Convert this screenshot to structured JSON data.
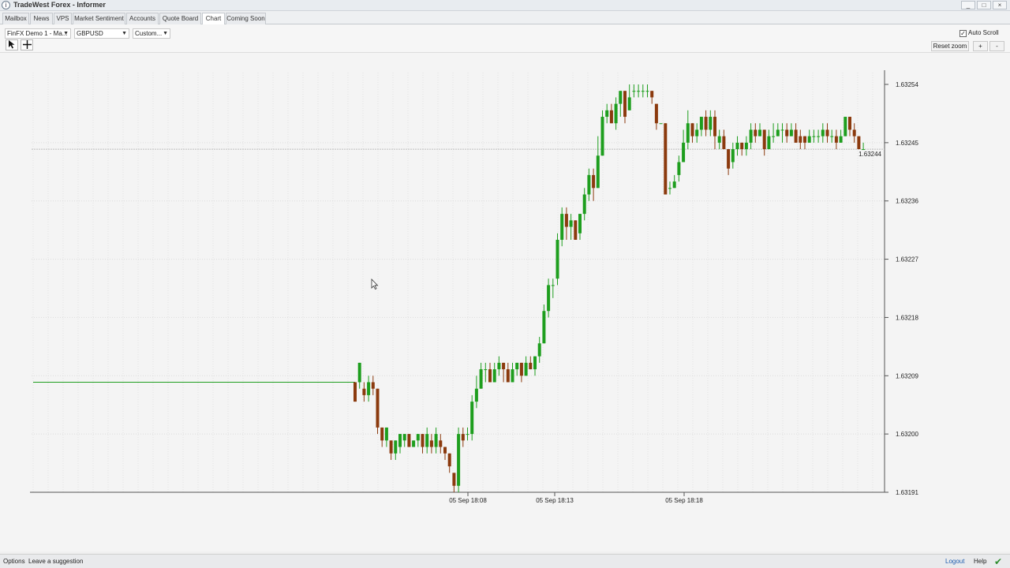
{
  "window": {
    "title": "TradeWest Forex - Informer",
    "icon": "info-icon",
    "controls": [
      "_",
      "□",
      "×"
    ]
  },
  "tabs": [
    {
      "label": "Mailbox",
      "active": false
    },
    {
      "label": "News",
      "active": false
    },
    {
      "label": "VPS",
      "active": false
    },
    {
      "label": "Market Sentiment",
      "active": false
    },
    {
      "label": "Accounts",
      "active": false
    },
    {
      "label": "Quote Board",
      "active": false
    },
    {
      "label": "Chart",
      "active": true
    },
    {
      "label": "Coming Soon",
      "active": false
    }
  ],
  "toolbar": {
    "account_select": "FinFX Demo 1 - Ma...",
    "symbol_select": "GBPUSD",
    "timeframe_select": "Custom...",
    "pointer_tool_icon": "cursor-icon",
    "crosshair_tool_icon": "crosshair-icon",
    "auto_scroll_label": "Auto Scroll",
    "auto_scroll_checked": true,
    "reset_zoom_label": "Reset zoom",
    "zoom_in_label": "+",
    "zoom_out_label": "-"
  },
  "chart_data": {
    "type": "candlestick",
    "symbol": "GBPUSD",
    "y_ticks": [
      "1.63254",
      "1.63245",
      "1.63236",
      "1.63227",
      "1.63218",
      "1.63209",
      "1.63200",
      "1.63191"
    ],
    "ylim": [
      1.63191,
      1.63254
    ],
    "x_ticks": [
      "05 Sep 18:08",
      "05 Sep 18:13",
      "05 Sep 18:18"
    ],
    "current_price": "1.63244",
    "up_color": "#1e9e1e",
    "down_color": "#8b3a0e",
    "flat_price_before_start": 1.63208,
    "candles": [
      [
        1.63208,
        1.63205,
        1.63208,
        1.63205
      ],
      [
        1.63208,
        1.63211,
        1.63211,
        1.63207
      ],
      [
        1.63207,
        1.63206,
        1.63208,
        1.63205
      ],
      [
        1.63206,
        1.63208,
        1.63209,
        1.63205
      ],
      [
        1.63208,
        1.63207,
        1.63209,
        1.63206
      ],
      [
        1.63207,
        1.63201,
        1.63207,
        1.632
      ],
      [
        1.63201,
        1.63199,
        1.63201,
        1.63198
      ],
      [
        1.63199,
        1.63201,
        1.63201,
        1.63198
      ],
      [
        1.63199,
        1.63197,
        1.63199,
        1.63196
      ],
      [
        1.63197,
        1.63199,
        1.63199,
        1.63196
      ],
      [
        1.63198,
        1.632,
        1.632,
        1.63197
      ],
      [
        1.63199,
        1.632,
        1.632,
        1.63198
      ],
      [
        1.632,
        1.63198,
        1.632,
        1.63198
      ],
      [
        1.63198,
        1.63199,
        1.63199,
        1.63198
      ],
      [
        1.63199,
        1.632,
        1.632,
        1.63198
      ],
      [
        1.632,
        1.63198,
        1.632,
        1.63197
      ],
      [
        1.63198,
        1.632,
        1.63201,
        1.63197
      ],
      [
        1.63199,
        1.63198,
        1.632,
        1.63197
      ],
      [
        1.63198,
        1.632,
        1.63201,
        1.63197
      ],
      [
        1.63199,
        1.63198,
        1.632,
        1.63197
      ],
      [
        1.63198,
        1.63197,
        1.63198,
        1.63196
      ],
      [
        1.63197,
        1.63195,
        1.63197,
        1.63194
      ],
      [
        1.63194,
        1.63192,
        1.63194,
        1.63191
      ],
      [
        1.63192,
        1.632,
        1.63201,
        1.63191
      ],
      [
        1.632,
        1.63199,
        1.63201,
        1.63198
      ],
      [
        1.632,
        1.632,
        1.63201,
        1.63199
      ],
      [
        1.632,
        1.63205,
        1.63206,
        1.63199
      ],
      [
        1.63205,
        1.63207,
        1.63209,
        1.63204
      ],
      [
        1.63207,
        1.6321,
        1.63211,
        1.63207
      ],
      [
        1.6321,
        1.6321,
        1.63211,
        1.63208
      ],
      [
        1.6321,
        1.63208,
        1.63211,
        1.63208
      ],
      [
        1.63208,
        1.6321,
        1.63211,
        1.63208
      ],
      [
        1.6321,
        1.63211,
        1.63212,
        1.63209
      ],
      [
        1.63211,
        1.6321,
        1.63211,
        1.63208
      ],
      [
        1.6321,
        1.63208,
        1.63211,
        1.63208
      ],
      [
        1.63208,
        1.6321,
        1.63211,
        1.63208
      ],
      [
        1.6321,
        1.63211,
        1.63211,
        1.63209
      ],
      [
        1.63211,
        1.63209,
        1.63211,
        1.63208
      ],
      [
        1.63209,
        1.63211,
        1.63212,
        1.63209
      ],
      [
        1.63211,
        1.6321,
        1.63212,
        1.6321
      ],
      [
        1.6321,
        1.63212,
        1.63212,
        1.63209
      ],
      [
        1.63212,
        1.63214,
        1.63215,
        1.63211
      ],
      [
        1.63214,
        1.63219,
        1.6322,
        1.63214
      ],
      [
        1.63219,
        1.63223,
        1.63224,
        1.63218
      ],
      [
        1.63223,
        1.63223,
        1.63224,
        1.63221
      ],
      [
        1.63224,
        1.6323,
        1.63231,
        1.63223
      ],
      [
        1.6323,
        1.63234,
        1.63235,
        1.63229
      ],
      [
        1.63234,
        1.63232,
        1.63235,
        1.6323
      ],
      [
        1.63232,
        1.63233,
        1.63234,
        1.6323
      ],
      [
        1.63233,
        1.6323,
        1.63233,
        1.6323
      ],
      [
        1.63231,
        1.63234,
        1.63234,
        1.6323
      ],
      [
        1.63234,
        1.63237,
        1.63238,
        1.63233
      ],
      [
        1.63237,
        1.6324,
        1.63241,
        1.63236
      ],
      [
        1.6324,
        1.63238,
        1.63241,
        1.63236
      ],
      [
        1.63238,
        1.63243,
        1.63246,
        1.63238
      ],
      [
        1.63243,
        1.63249,
        1.6325,
        1.63243
      ],
      [
        1.63249,
        1.6325,
        1.63251,
        1.63248
      ],
      [
        1.6325,
        1.63248,
        1.63251,
        1.63248
      ],
      [
        1.63248,
        1.63251,
        1.63252,
        1.63247
      ],
      [
        1.63251,
        1.63253,
        1.63253,
        1.63249
      ],
      [
        1.63253,
        1.63249,
        1.63253,
        1.63248
      ],
      [
        1.6325,
        1.63252,
        1.63254,
        1.6325
      ],
      [
        1.63253,
        1.63253,
        1.63254,
        1.63252
      ],
      [
        1.63253,
        1.63253,
        1.63254,
        1.63252
      ],
      [
        1.63253,
        1.63253,
        1.63254,
        1.63252
      ],
      [
        1.63253,
        1.63253,
        1.63254,
        1.63252
      ],
      [
        1.63253,
        1.63252,
        1.63253,
        1.63251
      ],
      [
        1.63251,
        1.63248,
        1.63251,
        1.63247
      ],
      [
        1.63248,
        1.63248,
        1.63248,
        1.63248
      ],
      [
        1.63248,
        1.63237,
        1.63248,
        1.63237
      ],
      [
        1.63238,
        1.63238,
        1.63239,
        1.63237
      ],
      [
        1.63238,
        1.63239,
        1.6324,
        1.63238
      ],
      [
        1.6324,
        1.63242,
        1.63243,
        1.63239
      ],
      [
        1.63242,
        1.63245,
        1.63247,
        1.63242
      ],
      [
        1.63245,
        1.63248,
        1.6325,
        1.63244
      ],
      [
        1.63248,
        1.63246,
        1.63248,
        1.63245
      ],
      [
        1.63246,
        1.63247,
        1.63248,
        1.63245
      ],
      [
        1.63247,
        1.63249,
        1.63249,
        1.63246
      ],
      [
        1.63249,
        1.63247,
        1.6325,
        1.63246
      ],
      [
        1.63247,
        1.63249,
        1.6325,
        1.63246
      ],
      [
        1.63249,
        1.63246,
        1.6325,
        1.63244
      ],
      [
        1.63245,
        1.63246,
        1.63247,
        1.63244
      ],
      [
        1.63246,
        1.63244,
        1.63247,
        1.63244
      ],
      [
        1.63244,
        1.63241,
        1.63244,
        1.6324
      ],
      [
        1.63242,
        1.63244,
        1.63245,
        1.63241
      ],
      [
        1.63244,
        1.63245,
        1.63246,
        1.63243
      ],
      [
        1.63245,
        1.63244,
        1.63245,
        1.63243
      ],
      [
        1.63244,
        1.63245,
        1.63246,
        1.63243
      ],
      [
        1.63245,
        1.63247,
        1.63248,
        1.63244
      ],
      [
        1.63247,
        1.63246,
        1.63248,
        1.63245
      ],
      [
        1.63246,
        1.63247,
        1.63248,
        1.63246
      ],
      [
        1.63247,
        1.63244,
        1.63247,
        1.63243
      ],
      [
        1.63244,
        1.63246,
        1.63247,
        1.63244
      ],
      [
        1.63246,
        1.63246,
        1.63248,
        1.63245
      ],
      [
        1.63246,
        1.63247,
        1.63248,
        1.63246
      ],
      [
        1.63247,
        1.63247,
        1.63248,
        1.63245
      ],
      [
        1.63247,
        1.63246,
        1.63248,
        1.63245
      ],
      [
        1.63246,
        1.63247,
        1.63248,
        1.63246
      ],
      [
        1.63247,
        1.63245,
        1.63248,
        1.63245
      ],
      [
        1.63246,
        1.63245,
        1.63247,
        1.63244
      ],
      [
        1.63246,
        1.63245,
        1.63246,
        1.63244
      ],
      [
        1.63245,
        1.63246,
        1.63247,
        1.63245
      ],
      [
        1.63246,
        1.63246,
        1.63247,
        1.63245
      ],
      [
        1.63246,
        1.63246,
        1.63247,
        1.63245
      ],
      [
        1.63246,
        1.63247,
        1.63248,
        1.63245
      ],
      [
        1.63247,
        1.63246,
        1.63248,
        1.63245
      ],
      [
        1.63246,
        1.63246,
        1.63247,
        1.63245
      ],
      [
        1.63246,
        1.63245,
        1.63247,
        1.63244
      ],
      [
        1.63245,
        1.63246,
        1.63247,
        1.63245
      ],
      [
        1.63246,
        1.63249,
        1.63249,
        1.63246
      ],
      [
        1.63249,
        1.63247,
        1.63249,
        1.63246
      ],
      [
        1.63247,
        1.63246,
        1.63248,
        1.63245
      ],
      [
        1.63246,
        1.63244,
        1.63246,
        1.63244
      ],
      [
        1.63244,
        1.63244,
        1.63245,
        1.63244
      ]
    ]
  },
  "statusbar": {
    "options_label": "Options",
    "suggestion_label": "Leave a suggestion",
    "logout_label": "Logout",
    "help_label": "Help",
    "ok_icon": "check-icon"
  }
}
